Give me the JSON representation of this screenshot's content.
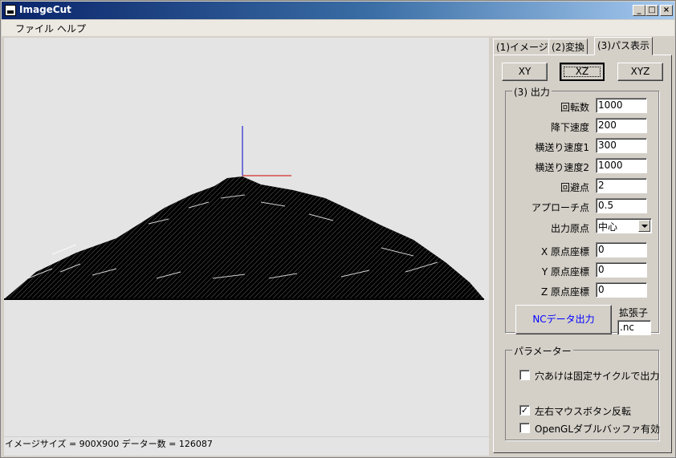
{
  "window": {
    "title": "ImageCut"
  },
  "menu": {
    "items": [
      "ファイル",
      "ヘルプ"
    ]
  },
  "tabs": [
    "(1)イメージ",
    "(2)変換",
    "(3)パス表示"
  ],
  "view_buttons": [
    "XY",
    "XZ",
    "XYZ"
  ],
  "output_group": {
    "title": "(3) 出力",
    "fields": [
      {
        "label": "回転数",
        "value": "1000"
      },
      {
        "label": "降下速度",
        "value": "200"
      },
      {
        "label": "横送り速度1",
        "value": "300"
      },
      {
        "label": "横送り速度2",
        "value": "1000"
      },
      {
        "label": "回避点",
        "value": "2"
      },
      {
        "label": "アプローチ点",
        "value": "0.5"
      }
    ],
    "origin_label": "出力原点",
    "origin_value": "中心",
    "coords": [
      {
        "label": "X 原点座標",
        "value": "0"
      },
      {
        "label": "Y 原点座標",
        "value": "0"
      },
      {
        "label": "Z 原点座標",
        "value": "0"
      }
    ],
    "nc_button": "NCデータ出力",
    "ext_label": "拡張子",
    "ext_value": ".nc"
  },
  "param_group": {
    "title": "パラメーター",
    "checks": [
      {
        "label": "穴あけは固定サイクルで出力",
        "checked": false
      },
      {
        "label": "左右マウスボタン反転",
        "checked": true
      },
      {
        "label": "OpenGLダブルバッファ有効",
        "checked": false
      }
    ]
  },
  "status": {
    "text": "イメージサイズ = 900X900  データー数 = 126087"
  },
  "colors": {
    "titlebar": "#0a246a",
    "nc_button_text": "#0000ff",
    "axis_z": "#0000cc",
    "axis_x": "#cc0000"
  }
}
